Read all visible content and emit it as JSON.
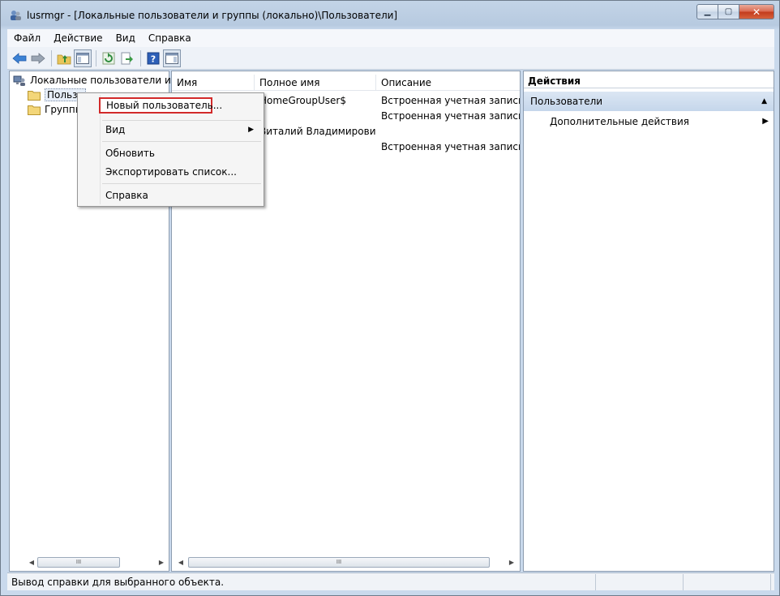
{
  "window": {
    "title": "lusrmgr - [Локальные пользователи и группы (локально)\\Пользователи]",
    "minimize_glyph": "▁",
    "maximize_glyph": "▢",
    "close_glyph": "✕"
  },
  "menubar": {
    "items": [
      "Файл",
      "Действие",
      "Вид",
      "Справка"
    ]
  },
  "toolbar": {
    "icons": [
      "back-arrow-icon",
      "forward-arrow-icon",
      "up-folder-icon",
      "show-hide-console-tree-icon",
      "refresh-icon",
      "export-list-icon",
      "help-icon",
      "show-hide-action-pane-icon"
    ]
  },
  "tree": {
    "root_label": "Локальные пользователи и гру",
    "users_label": "Пользо",
    "groups_label": "Группы"
  },
  "list": {
    "columns": [
      "Имя",
      "Полное имя",
      "Описание"
    ],
    "rows": [
      {
        "name": "",
        "full_name": "HomeGroupUser$",
        "description": "Встроенная учетная запись для"
      },
      {
        "name": "",
        "full_name": "",
        "description": "Встроенная учетная запись адм"
      },
      {
        "name": "",
        "full_name": "Виталий Владимирович",
        "description": ""
      },
      {
        "name": "",
        "full_name": "",
        "description": "Встроенная учетная запись для"
      }
    ]
  },
  "actions": {
    "header": "Действия",
    "section": "Пользователи",
    "more_actions": "Дополнительные действия"
  },
  "context_menu": {
    "new_user": "Новый пользователь...",
    "view": "Вид",
    "refresh": "Обновить",
    "export_list": "Экспортировать список...",
    "help": "Справка"
  },
  "statusbar": {
    "text": "Вывод справки для выбранного объекта."
  },
  "scrollbar": {
    "grip": "III",
    "left_arrow": "◀",
    "right_arrow": "▶"
  },
  "colors": {
    "highlight_border": "#d22a2a",
    "section_bg": "#c5d6eb"
  }
}
